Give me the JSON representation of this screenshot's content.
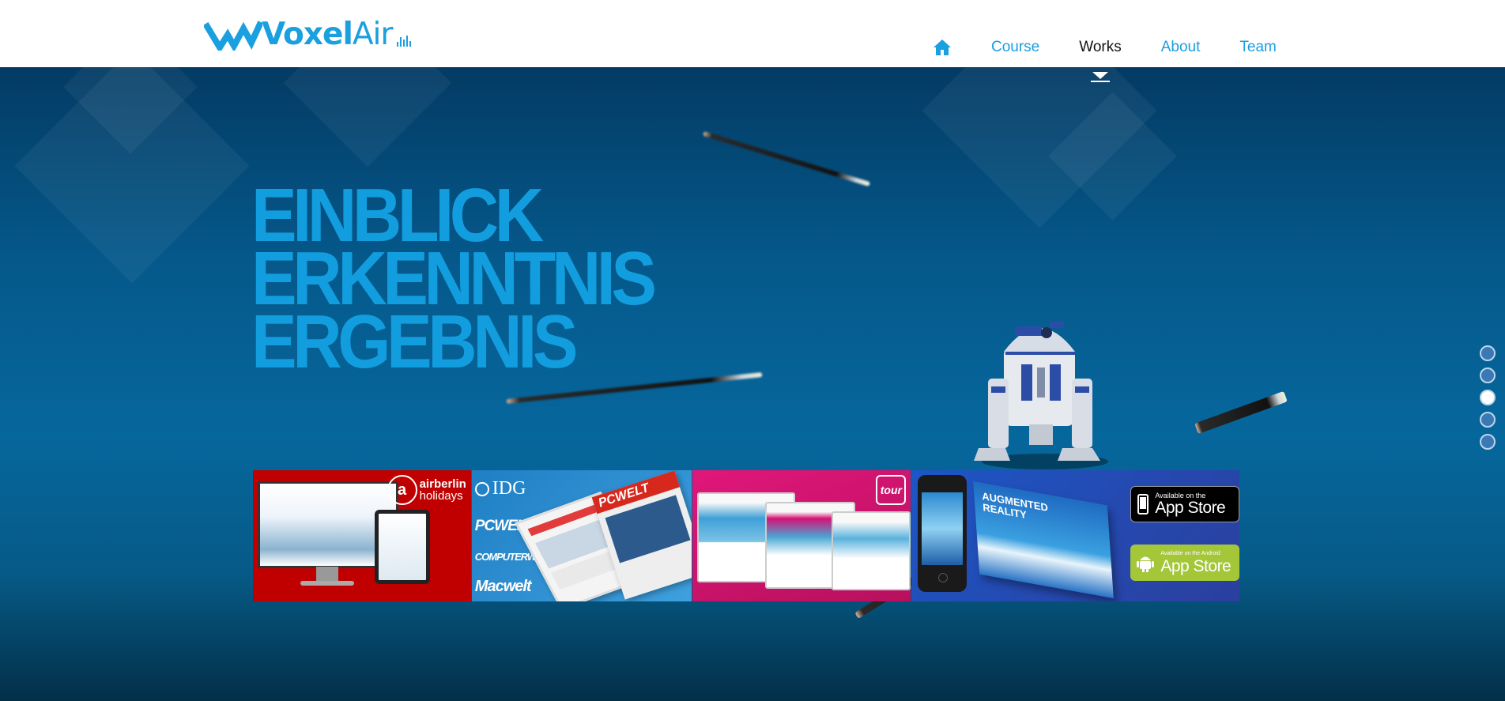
{
  "brand": {
    "name_bold": "Voxel",
    "name_light": "Air",
    "logo_icon": "voxelair-logo-icon"
  },
  "nav": {
    "home_icon": "home-icon",
    "items": [
      {
        "label": "Course",
        "active": false
      },
      {
        "label": "Works",
        "active": true
      },
      {
        "label": "About",
        "active": false
      },
      {
        "label": "Team",
        "active": false
      }
    ]
  },
  "hero": {
    "headline": [
      "EINBLICK",
      "ERKENNTNIS",
      "ERGEBNIS"
    ]
  },
  "tiles": [
    {
      "name": "airberlin-tile",
      "logo_line1": "airberlin",
      "logo_line2": "holidays"
    },
    {
      "name": "idg-tile",
      "publisher": "IDG",
      "mags": [
        "PCWELT",
        "COMPUTERWOCHE",
        "Macwelt"
      ],
      "cover_title": "PCWELT"
    },
    {
      "name": "tour-tile",
      "logo": "tour"
    },
    {
      "name": "augmented-reality-tile",
      "book_title": "AUGMENTED REALITY",
      "badge_ios_small": "Available on the",
      "badge_ios_big": "App Store",
      "badge_android_small": "Available on the Android",
      "badge_android_big": "App Store"
    }
  ],
  "pagination": {
    "count": 5,
    "active_index": 2
  },
  "colors": {
    "accent": "#1a9fdf",
    "headline": "#129ddf",
    "hero_bg": "#05588a",
    "airberlin_red": "#c00000",
    "android_green": "#a4c639"
  }
}
